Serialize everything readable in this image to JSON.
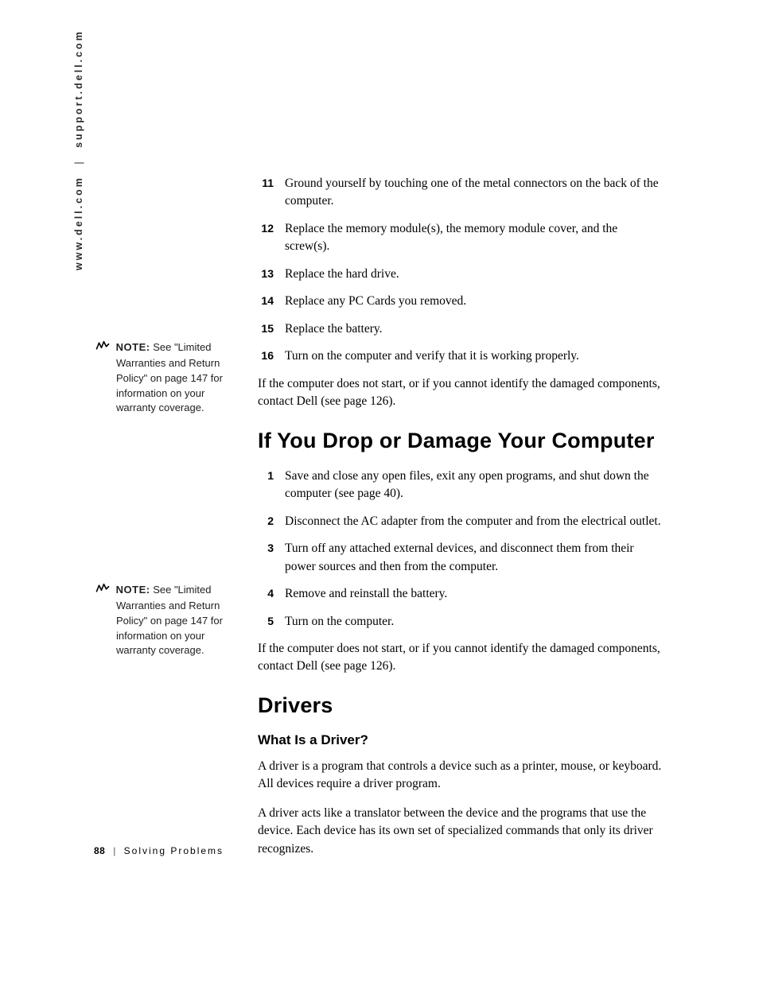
{
  "side_url_left": "www.dell.com",
  "side_url_right": "support.dell.com",
  "notes": {
    "a": {
      "label": "NOTE:",
      "text": "See \"Limited Warranties and Return Policy\" on page 147 for information on your warranty coverage."
    },
    "b": {
      "label": "NOTE:",
      "text": "See \"Limited Warranties and Return Policy\" on page 147 for information on your warranty coverage."
    }
  },
  "steps1": {
    "s11": {
      "n": "11",
      "t": "Ground yourself by touching one of the metal connectors on the back of the computer."
    },
    "s12": {
      "n": "12",
      "t": "Replace the memory module(s), the memory module cover, and the screw(s)."
    },
    "s13": {
      "n": "13",
      "t": "Replace the hard drive."
    },
    "s14": {
      "n": "14",
      "t": "Replace any PC Cards you removed."
    },
    "s15": {
      "n": "15",
      "t": "Replace the battery."
    },
    "s16": {
      "n": "16",
      "t": "Turn on the computer and verify that it is working properly."
    }
  },
  "para_after1": "If the computer does not start, or if you cannot identify the damaged components, contact Dell (see page 126).",
  "heading2": "If You Drop or Damage Your Computer",
  "steps2": {
    "s1": {
      "n": "1",
      "t": "Save and close any open files, exit any open programs, and shut down the computer (see page 40)."
    },
    "s2": {
      "n": "2",
      "t": "Disconnect the AC adapter from the computer and from the electrical outlet."
    },
    "s3": {
      "n": "3",
      "t": "Turn off any attached external devices, and disconnect them from their power sources and then from the computer."
    },
    "s4": {
      "n": "4",
      "t": "Remove and reinstall the battery."
    },
    "s5": {
      "n": "5",
      "t": "Turn on the computer."
    }
  },
  "para_after2": "If the computer does not start, or if you cannot identify the damaged components, contact Dell (see page 126).",
  "heading3": "Drivers",
  "sub3": "What Is a Driver?",
  "drivers_p1": "A driver is a program that controls a device such as a printer, mouse, or keyboard. All devices require a driver program.",
  "drivers_p2": "A driver acts like a translator between the device and the programs that use the device. Each device has its own set of specialized commands that only its driver recognizes.",
  "footer": {
    "page": "88",
    "section": "Solving Problems"
  }
}
